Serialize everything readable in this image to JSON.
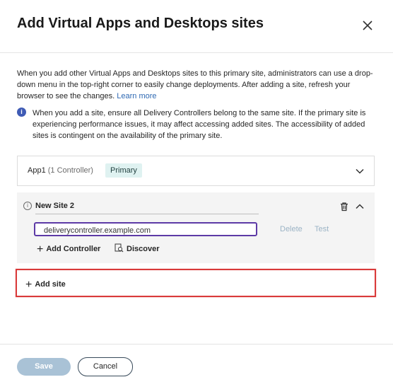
{
  "dialog": {
    "title": "Add Virtual Apps and Desktops sites",
    "close_icon": "close-icon"
  },
  "intro": {
    "text": "When you add other Virtual Apps and Desktops sites to this primary site, administrators can use a drop-down menu in the top-right corner to easily change deployments. After adding a site, refresh your browser to see the changes. ",
    "link": "Learn more"
  },
  "note": {
    "icon": "info-icon",
    "text": "When you add a site, ensure all Delivery Controllers belong to the same site. If the primary site is experiencing performance issues, it may affect accessing added sites. The accessibility of added sites is contingent on the availability of the primary site."
  },
  "sites": {
    "existing": {
      "name": "App1",
      "controllers": "(1 Controller)",
      "badge": "Primary"
    },
    "new_site": {
      "name": "New Site 2",
      "controller_value": "deliverycontroller.example.com",
      "delete_label": "Delete",
      "test_label": "Test",
      "add_controller_label": "Add Controller",
      "discover_label": "Discover"
    }
  },
  "add_site": {
    "label": "Add site"
  },
  "footer": {
    "save_label": "Save",
    "cancel_label": "Cancel"
  },
  "colors": {
    "accent_purple": "#5d3aa6",
    "highlight_red": "#d93a3a",
    "badge_bg": "#dff2f1",
    "save_disabled": "#a9c2d6"
  }
}
